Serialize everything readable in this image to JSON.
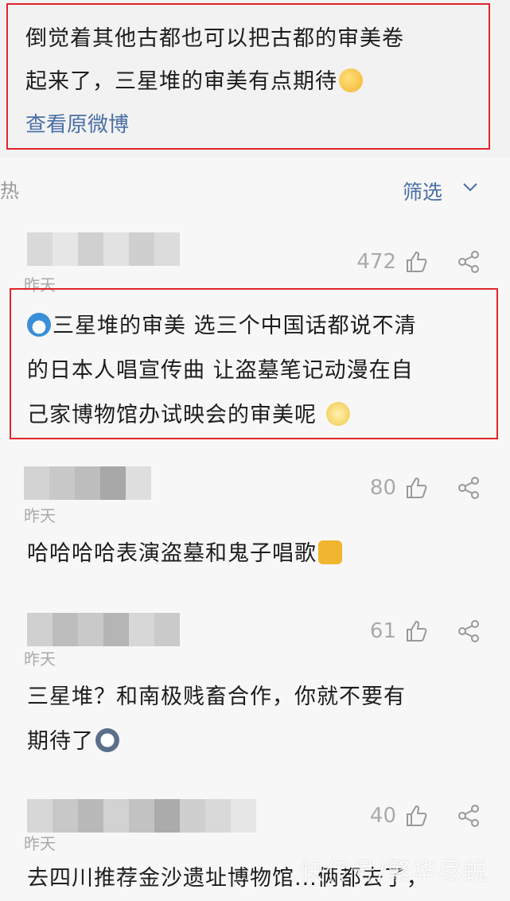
{
  "post": {
    "text_line1": "倒觉着其他古都也可以把古都的审美卷",
    "text_line2": "起来了，三星堆的审美有点期待",
    "view_original": "查看原微博"
  },
  "filter": {
    "hot_label": "热",
    "filter_label": "筛选"
  },
  "comments": [
    {
      "time": "昨天",
      "likes": "472",
      "lines": [
        "三星堆的审美 选三个中国话都说不清",
        "的日本人唱宣传曲 让盗墓笔记动漫在自",
        "己家博物馆办试映会的审美呢"
      ]
    },
    {
      "time": "昨天",
      "likes": "80",
      "lines": [
        "哈哈哈哈表演盗墓和鬼子唱歌"
      ]
    },
    {
      "time": "昨天",
      "likes": "61",
      "lines": [
        "三星堆？和南极贱畜合作，你就不要有",
        "期待了"
      ]
    },
    {
      "time": "昨天",
      "likes": "40",
      "lines": [
        "去四川推荐金沙遗址博物馆...俩都去了，"
      ]
    }
  ],
  "watermark": "快传号/繁华尽蜕",
  "colors": {
    "highlight_border": "#e0262b",
    "link": "#4a6fa5"
  }
}
